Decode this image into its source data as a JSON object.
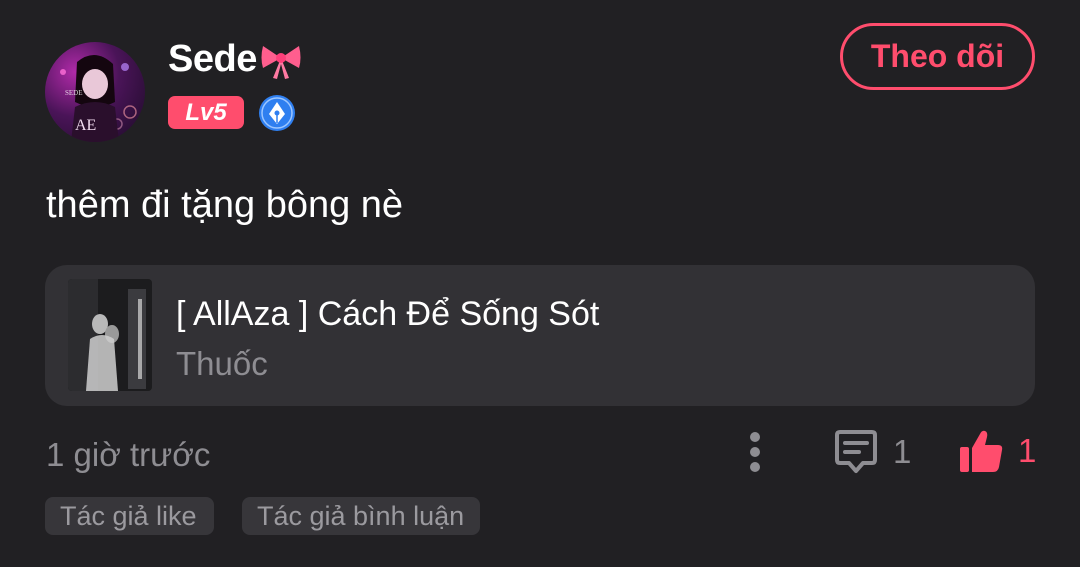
{
  "user": {
    "name": "Sede",
    "level": "Lv5",
    "avatar_icon": "profile-photo",
    "badge_icon": "pen-nib-icon"
  },
  "follow_button": {
    "label": "Theo dõi"
  },
  "comment": {
    "text": "thêm đi tặng bông nè"
  },
  "story": {
    "title": "[ AllAza ] Cách Để Sống Sót",
    "author": "Thuốc"
  },
  "meta": {
    "timestamp": "1 giờ trước",
    "comment_count": "1",
    "like_count": "1"
  },
  "tags": [
    "Tác giả like",
    "Tác giả bình luận"
  ],
  "colors": {
    "background": "#212023",
    "accent": "#ff4d6d",
    "card": "#323135",
    "muted_text": "#8e8d92"
  }
}
